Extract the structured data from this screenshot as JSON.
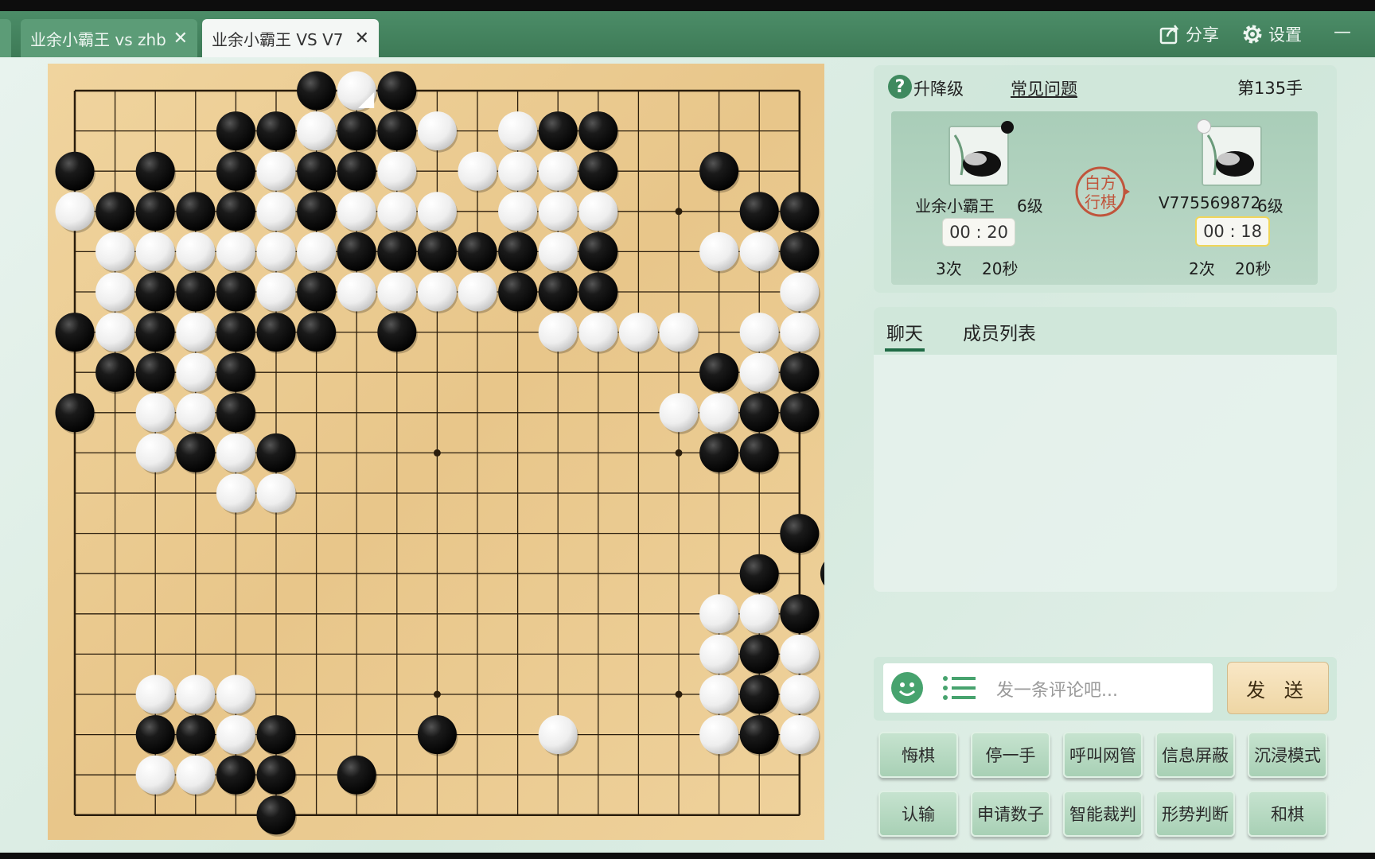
{
  "tabs": [
    {
      "label": "业余小霸王 vs zhb",
      "active": false
    },
    {
      "label": "业余小霸王 VS V7",
      "active": true
    }
  ],
  "topbar": {
    "share_label": "分享",
    "settings_label": "设置",
    "minimize_label": "—"
  },
  "info": {
    "promote_label": "升降级",
    "faq_label": "常见问题",
    "move_count": "第135手",
    "turn_label": "白方行棋"
  },
  "players": {
    "black": {
      "name": "业余小霸王",
      "rank": "6级",
      "timer": "00 : 20",
      "byoyomi_times": "3次",
      "byoyomi_secs": "20秒"
    },
    "white": {
      "name": "V775569872",
      "rank": "6级",
      "timer": "00 : 18",
      "byoyomi_times": "2次",
      "byoyomi_secs": "20秒"
    }
  },
  "chat": {
    "tab_chat": "聊天",
    "tab_members": "成员列表",
    "placeholder": "发一条评论吧...",
    "send_label": "发 送"
  },
  "actions": [
    "悔棋",
    "停一手",
    "呼叫网管",
    "信息屏蔽",
    "沉浸模式",
    "认输",
    "申请数子",
    "智能裁判",
    "形势判断",
    "和棋"
  ],
  "board": {
    "size": 19,
    "rows": [
      "......XOX..........",
      "....XXOXXO.OXX.....",
      "X.X.XOXXO.OOOX..X..",
      "OXXXXOXOOO.OOO...XX",
      ".OOOOOOXXXXXOX..OOX",
      ".OXXXOXOOOOXXX....O",
      "XOXOXXX.X...OOOO.OO",
      ".XXOX...........XOX",
      "X.OOX..........OOXX",
      "..OXOX..........XX.",
      "....OO.............",
      "..................X",
      ".................X.X",
      "................OOX",
      "................OXO",
      "..OOO...........OXO",
      "..XXOX...X..O...OXO",
      "..OOXX.X...........",
      ".....X............."
    ],
    "last_move": [
      0,
      7
    ]
  }
}
